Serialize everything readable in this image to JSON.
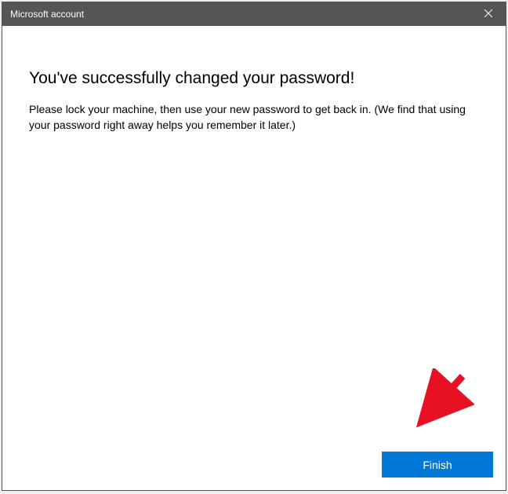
{
  "titlebar": {
    "title": "Microsoft account"
  },
  "content": {
    "heading": "You've successfully changed your password!",
    "description": "Please lock your machine, then use your new password to get back in. (We find that using your password right away helps you remember it later.)"
  },
  "footer": {
    "finish_label": "Finish"
  }
}
